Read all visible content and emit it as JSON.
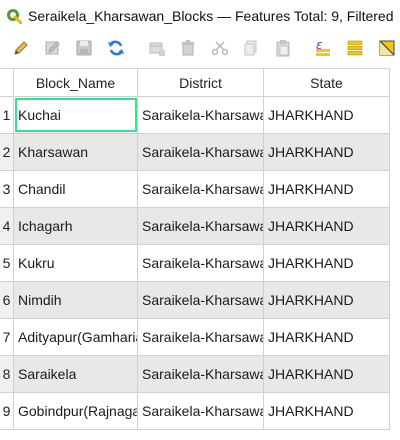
{
  "window": {
    "title": "Seraikela_Kharsawan_Blocks — Features Total: 9, Filtered"
  },
  "toolbar": {
    "buttons": [
      {
        "icon": "pencil-icon",
        "name": "toggle-editing"
      },
      {
        "icon": "multi-edit-icon",
        "name": "multi-edit"
      },
      {
        "icon": "save-icon",
        "name": "save-edits"
      },
      {
        "icon": "refresh-icon",
        "name": "reload"
      },
      {
        "icon": "add-feature-icon",
        "name": "add-feature"
      },
      {
        "icon": "delete-icon",
        "name": "delete-selected"
      },
      {
        "icon": "cut-icon",
        "name": "cut"
      },
      {
        "icon": "copy-icon",
        "name": "copy"
      },
      {
        "icon": "paste-icon",
        "name": "paste"
      },
      {
        "icon": "expression-select-icon",
        "name": "select-by-expression"
      },
      {
        "icon": "select-all-icon",
        "name": "select-all"
      },
      {
        "icon": "invert-selection-icon",
        "name": "invert-selection"
      }
    ]
  },
  "table": {
    "columns": [
      "Block_Name",
      "District",
      "State"
    ],
    "rows": [
      {
        "num": "1",
        "block": "Kuchai",
        "district": "Saraikela-Kharsawan",
        "state": "JHARKHAND"
      },
      {
        "num": "2",
        "block": "Kharsawan",
        "district": "Saraikela-Kharsawan",
        "state": "JHARKHAND"
      },
      {
        "num": "3",
        "block": "Chandil",
        "district": "Saraikela-Kharsawan",
        "state": "JHARKHAND"
      },
      {
        "num": "4",
        "block": "Ichagarh",
        "district": "Saraikela-Kharsawan",
        "state": "JHARKHAND"
      },
      {
        "num": "5",
        "block": "Kukru",
        "district": "Saraikela-Kharsawan",
        "state": "JHARKHAND"
      },
      {
        "num": "6",
        "block": "Nimdih",
        "district": "Saraikela-Kharsawan",
        "state": "JHARKHAND"
      },
      {
        "num": "7",
        "block": "Adityapur(Gamharia)",
        "district": "Saraikela-Kharsawan",
        "state": "JHARKHAND"
      },
      {
        "num": "8",
        "block": "Saraikela",
        "district": "Saraikela-Kharsawan",
        "state": "JHARKHAND"
      },
      {
        "num": "9",
        "block": "Gobindpur(Rajnagar)",
        "district": "Saraikela-Kharsawan",
        "state": "JHARKHAND"
      }
    ]
  },
  "colors": {
    "alt_row": "#e9e8e6",
    "focus_outline": "#2ee58a",
    "qgis_green": "#589632",
    "refresh_blue": "#2b7bd6",
    "select_yellow": "#f5c518"
  }
}
